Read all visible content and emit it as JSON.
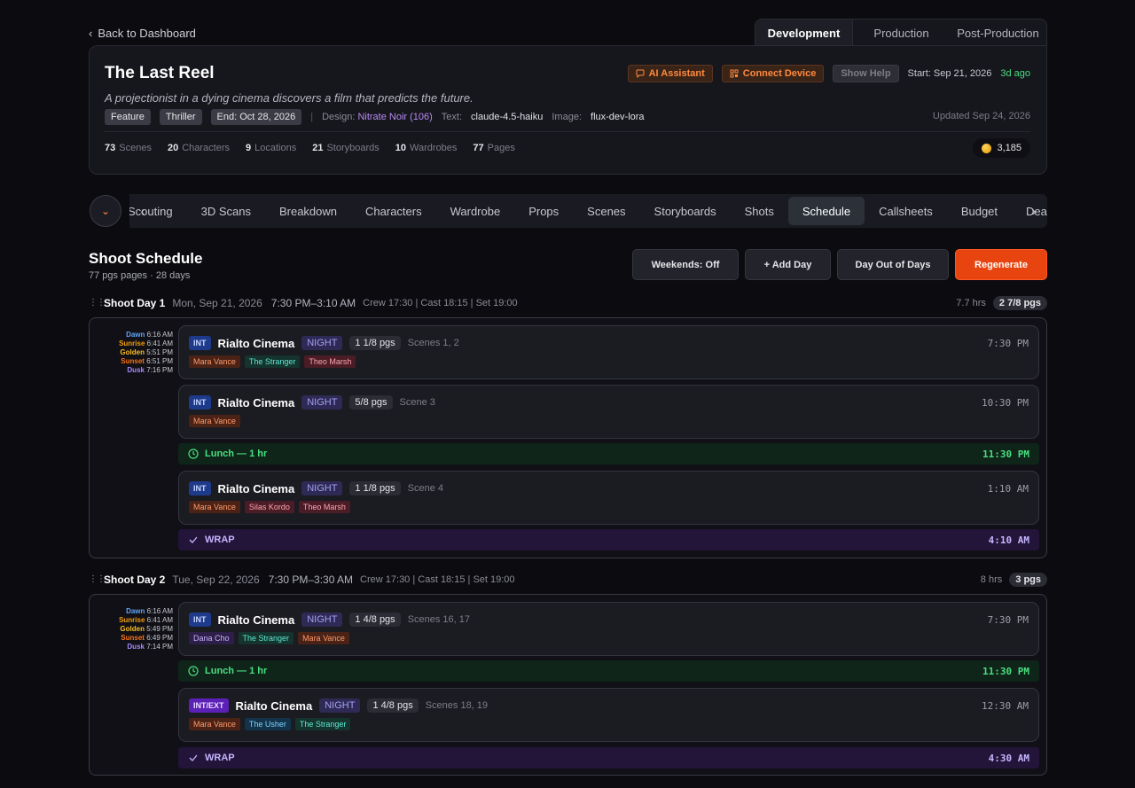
{
  "nav": {
    "back_label": "Back to Dashboard"
  },
  "phase_tabs": [
    "Development",
    "Production",
    "Post-Production"
  ],
  "project": {
    "title": "The Last Reel",
    "logline": "A projectionist in a dying cinema discovers a film that predicts the future.",
    "tags": [
      "Feature",
      "Thriller",
      "End: Oct 28, 2026"
    ],
    "design_label": "Design:",
    "design_value": "Nitrate Noir (106)",
    "text_label": "Text:",
    "text_value": "claude-4.5-haiku",
    "image_label": "Image:",
    "image_value": "flux-dev-lora",
    "ai_assistant": "AI Assistant",
    "connect_device": "Connect Device",
    "show_help": "Show Help",
    "start": "Start: Sep 21, 2026",
    "ago": "3d ago",
    "updated": "Updated Sep 24, 2026",
    "stats": [
      {
        "n": "73",
        "label": "Scenes"
      },
      {
        "n": "20",
        "label": "Characters"
      },
      {
        "n": "9",
        "label": "Locations"
      },
      {
        "n": "21",
        "label": "Storyboards"
      },
      {
        "n": "10",
        "label": "Wardrobes"
      },
      {
        "n": "77",
        "label": "Pages"
      }
    ],
    "credits": "3,185"
  },
  "section_tabs": [
    "Scouting",
    "3D Scans",
    "Breakdown",
    "Characters",
    "Wardrobe",
    "Props",
    "Scenes",
    "Storyboards",
    "Shots",
    "Schedule",
    "Callsheets",
    "Budget",
    "Deals"
  ],
  "active_section_tab": "Schedule",
  "schedule": {
    "title": "Shoot Schedule",
    "subtitle": "77 pgs pages · 28 days",
    "buttons": {
      "weekends": "Weekends: Off",
      "add_day": "+ Add Day",
      "dood": "Day Out of Days",
      "regenerate": "Regenerate"
    }
  },
  "days": [
    {
      "name": "Shoot Day 1",
      "date": "Mon, Sep 21, 2026",
      "time": "7:30 PM–3:10 AM",
      "calls": "Crew 17:30 | Cast 18:15 | Set 19:00",
      "hours": "7.7 hrs",
      "pages": "2 7/8 pgs",
      "sun": [
        {
          "l": "Dawn",
          "t": "6:16 AM"
        },
        {
          "l": "Sunrise",
          "t": "6:41 AM"
        },
        {
          "l": "Golden",
          "t": "5:51 PM"
        },
        {
          "l": "Sunset",
          "t": "6:51 PM"
        },
        {
          "l": "Dusk",
          "t": "7:16 PM"
        }
      ],
      "strips": [
        {
          "ie": "INT",
          "loc": "Rialto Cinema",
          "tod": "NIGHT",
          "pgs": "1 1/8 pgs",
          "scenes": "Scenes 1, 2",
          "time": "7:30 PM",
          "cast": [
            "Mara Vance",
            "The Stranger",
            "Theo Marsh"
          ]
        },
        {
          "ie": "INT",
          "loc": "Rialto Cinema",
          "tod": "NIGHT",
          "pgs": "5/8 pgs",
          "scenes": "Scene 3",
          "time": "10:30 PM",
          "cast": [
            "Mara Vance"
          ]
        },
        {
          "ie": "INT",
          "loc": "Rialto Cinema",
          "tod": "NIGHT",
          "pgs": "1 1/8 pgs",
          "scenes": "Scene 4",
          "time": "1:10 AM",
          "cast": [
            "Mara Vance",
            "Silas Kordo",
            "Theo Marsh"
          ]
        }
      ],
      "lunch": {
        "label": "Lunch — 1 hr",
        "time": "11:30 PM"
      },
      "wrap": {
        "label": "WRAP",
        "time": "4:10 AM"
      }
    },
    {
      "name": "Shoot Day 2",
      "date": "Tue, Sep 22, 2026",
      "time": "7:30 PM–3:30 AM",
      "calls": "Crew 17:30 | Cast 18:15 | Set 19:00",
      "hours": "8 hrs",
      "pages": "3 pgs",
      "sun": [
        {
          "l": "Dawn",
          "t": "6:16 AM"
        },
        {
          "l": "Sunrise",
          "t": "6:41 AM"
        },
        {
          "l": "Golden",
          "t": "5:49 PM"
        },
        {
          "l": "Sunset",
          "t": "6:49 PM"
        },
        {
          "l": "Dusk",
          "t": "7:14 PM"
        }
      ],
      "strips": [
        {
          "ie": "INT",
          "loc": "Rialto Cinema",
          "tod": "NIGHT",
          "pgs": "1 4/8 pgs",
          "scenes": "Scenes 16, 17",
          "time": "7:30 PM",
          "cast": [
            "Dana Cho",
            "The Stranger",
            "Mara Vance"
          ]
        },
        {
          "ie": "INT/EXT",
          "loc": "Rialto Cinema",
          "tod": "NIGHT",
          "pgs": "1 4/8 pgs",
          "scenes": "Scenes 18, 19",
          "time": "12:30 AM",
          "cast": [
            "Mara Vance",
            "The Usher",
            "The Stranger"
          ]
        }
      ],
      "lunch": {
        "label": "Lunch — 1 hr",
        "time": "11:30 PM"
      },
      "wrap": {
        "label": "WRAP",
        "time": "4:30 AM"
      }
    }
  ]
}
